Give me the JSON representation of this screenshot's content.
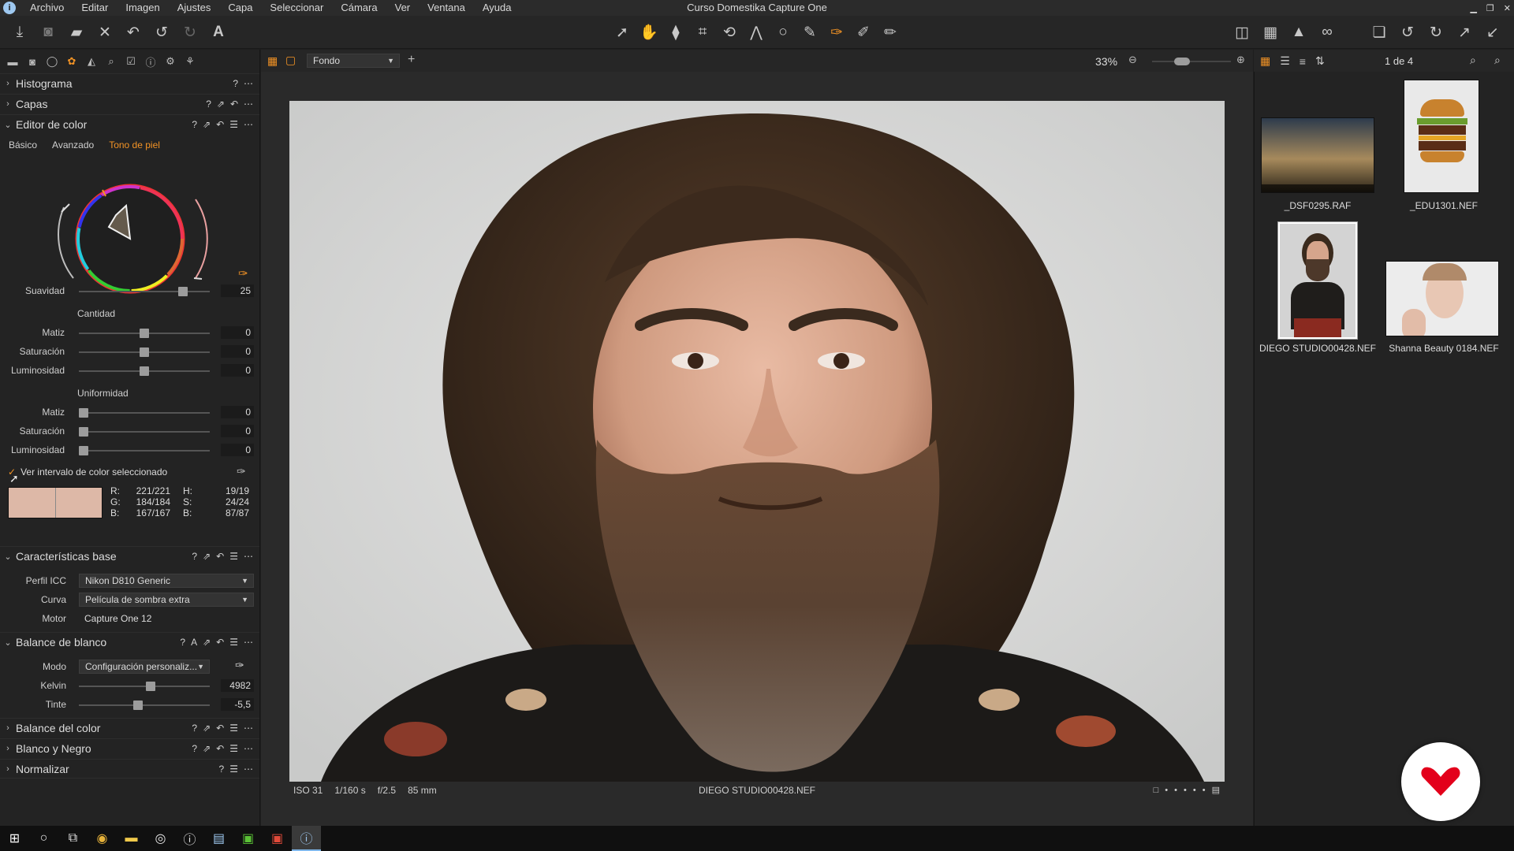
{
  "window": {
    "title": "Curso Domestika Capture One",
    "menus": [
      "Archivo",
      "Editar",
      "Imagen",
      "Ajustes",
      "Capa",
      "Seleccionar",
      "Cámara",
      "Ver",
      "Ventana",
      "Ayuda"
    ],
    "app_icon": "i"
  },
  "viewer": {
    "background_option": "Fondo",
    "zoom": "33%",
    "meta": {
      "iso": "ISO 31",
      "shutter": "1/160 s",
      "aperture": "f/2.5",
      "focal": "85 mm",
      "filename": "DIEGO STUDIO00428.NEF"
    }
  },
  "browser": {
    "counter": "1 de 4",
    "thumbnails": [
      {
        "name": "_DSF0295.RAF"
      },
      {
        "name": "_EDU1301.NEF"
      },
      {
        "name": "DIEGO STUDIO00428.NEF"
      },
      {
        "name": "Shanna Beauty 0184.NEF"
      }
    ]
  },
  "panel": {
    "histogram": {
      "title": "Histograma"
    },
    "layers": {
      "title": "Capas"
    },
    "color_editor": {
      "title": "Editor de color",
      "tabs": [
        "Básico",
        "Avanzado",
        "Tono de piel"
      ],
      "active_tab": 2,
      "smoothness": {
        "label": "Suavidad",
        "value": "25",
        "level": 0.82
      },
      "amount": {
        "title": "Cantidad",
        "hue": {
          "label": "Matiz",
          "value": "0",
          "level": 0.5
        },
        "saturation": {
          "label": "Saturación",
          "value": "0",
          "level": 0.5
        },
        "lightness": {
          "label": "Luminosidad",
          "value": "0",
          "level": 0.5
        }
      },
      "uniformity": {
        "title": "Uniformidad",
        "hue": {
          "label": "Matiz",
          "value": "0",
          "level": 0.0
        },
        "saturation": {
          "label": "Saturación",
          "value": "0",
          "level": 0.0
        },
        "lightness": {
          "label": "Luminosidad",
          "value": "0",
          "level": 0.0
        }
      },
      "view_range_label": "Ver intervalo de color seleccionado",
      "readout": {
        "r_label": "R:",
        "r": "221/221",
        "g_label": "G:",
        "g": "184/184",
        "b_label": "B:",
        "b": "167/167",
        "h_label": "H:",
        "h": "19/19",
        "s_label": "S:",
        "s": "24/24",
        "br_label": "B:",
        "br": "87/87"
      },
      "swatch_color": "#ddb8a7"
    },
    "base": {
      "title": "Características base",
      "icc": {
        "label": "Perfil ICC",
        "value": "Nikon D810 Generic"
      },
      "curve": {
        "label": "Curva",
        "value": "Película de sombra extra"
      },
      "engine": {
        "label": "Motor",
        "value": "Capture One 12"
      }
    },
    "white_balance": {
      "title": "Balance de blanco",
      "mode": {
        "label": "Modo",
        "value": "Configuración personaliz..."
      },
      "kelvin": {
        "label": "Kelvin",
        "value": "4982",
        "level": 0.55
      },
      "tint": {
        "label": "Tinte",
        "value": "-5,5",
        "level": 0.45
      }
    },
    "color_balance": {
      "title": "Balance del color"
    },
    "bw": {
      "title": "Blanco y Negro"
    },
    "normalize": {
      "title": "Normalizar"
    }
  },
  "colors": {
    "accent": "#f29325",
    "brand_red": "#e3001b"
  }
}
